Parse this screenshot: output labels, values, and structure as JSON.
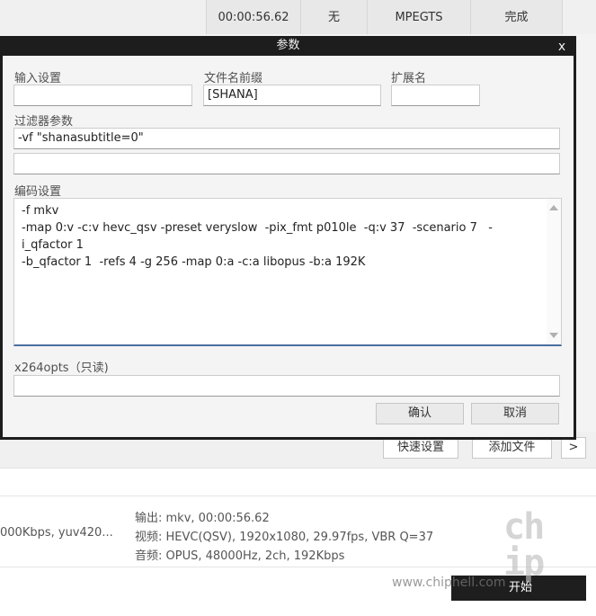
{
  "task_row": {
    "duration": "00:00:56.62",
    "status_col": "无",
    "format": "MPEGTS",
    "state": "完成"
  },
  "dialog": {
    "title": "参数",
    "close_glyph": "x",
    "input_settings_label": "输入设置",
    "input_settings_value": "",
    "filename_prefix_label": "文件名前缀",
    "filename_prefix_value": "[SHANA]",
    "extension_label": "扩展名",
    "extension_value": "",
    "filter_label": "过滤器参数",
    "filter_value_1": "-vf \"shanasubtitle=0\"",
    "filter_value_2": "",
    "encode_label": "编码设置",
    "encode_text": "-f mkv\n-map 0:v -c:v hevc_qsv -preset veryslow  -pix_fmt p010le  -q:v 37  -scenario 7   -i_qfactor 1\n-b_qfactor 1  -refs 4 -g 256 -map 0:a -c:a libopus -b:a 192K",
    "x264opts_label": "x264opts（只读)",
    "x264opts_value": "",
    "confirm_label": "确认",
    "cancel_label": "取消"
  },
  "toolbar": {
    "quick_settings_label": "快速设置",
    "add_file_label": "添加文件",
    "more_glyph": ">"
  },
  "file_info": {
    "source_fragment": "000Kbps,  yuv420...",
    "output_line": "输出: mkv, 00:00:56.62",
    "video_line": "视频: HEVC(QSV), 1920x1080, 29.97fps, VBR Q=37",
    "audio_line": "音频: OPUS, 48000Hz, 2ch, 192Kbps"
  },
  "start_label": "开始",
  "watermark": {
    "site": "www.chiphell.com",
    "logo": "chip\nhell"
  }
}
